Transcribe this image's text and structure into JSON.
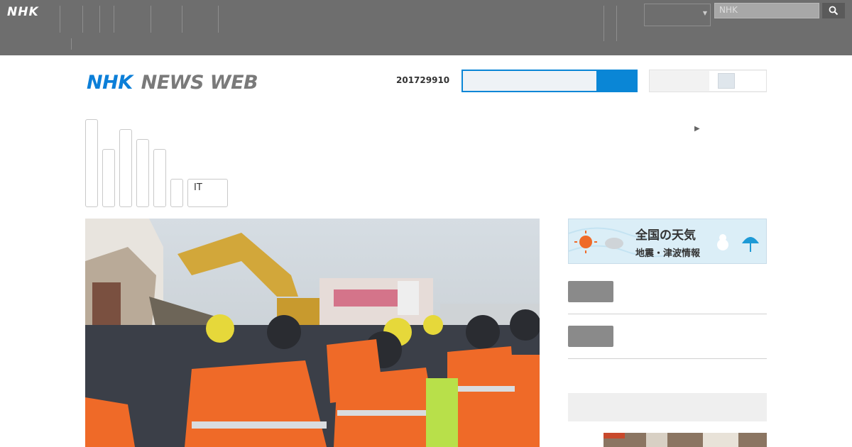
{
  "global": {
    "logo": "NHK",
    "nav": [
      {
        "l1": "",
        "l2": ""
      },
      {
        "l1": "",
        "l2": ""
      },
      {
        "l1": "",
        "l2": ""
      },
      {
        "l1": "",
        "l2": ""
      },
      {
        "l1": "",
        "l2": ""
      },
      {
        "l1": "",
        "l2": ""
      }
    ],
    "right_nav": [
      {
        "l1": "",
        "l2": ""
      },
      {
        "l1": "",
        "l2": ""
      }
    ],
    "region": "",
    "search_placeholder": "NHK"
  },
  "header": {
    "brand_nhk": "NHK",
    "brand_news": "NEWS WEB",
    "date": "201729910",
    "toggle_label": ""
  },
  "tabs": {
    "it_label": "IT"
  },
  "more_link": "",
  "weather": {
    "title": "全国の天気",
    "subtitle": "地震・津波情報"
  },
  "side_links": [
    {
      "label": ""
    },
    {
      "label": ""
    }
  ],
  "box_heading": "",
  "colors": {
    "brand_blue": "#0c7fd8",
    "link_blue": "#0d5f99",
    "topbar_gray": "#6e6e6e"
  }
}
